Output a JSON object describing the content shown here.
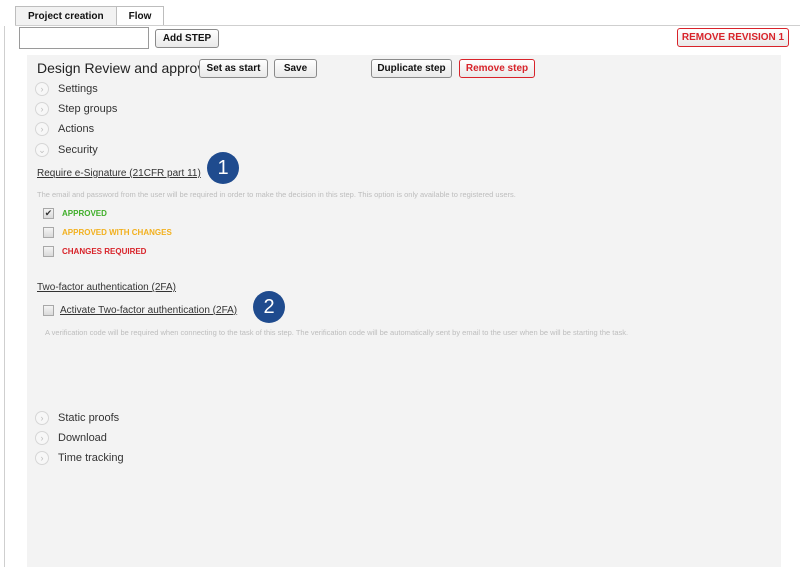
{
  "tabs": [
    {
      "label": "Project creation",
      "active": false
    },
    {
      "label": "Flow",
      "active": true
    }
  ],
  "toolbar": {
    "step_input_value": "",
    "add_step_label": "Add STEP",
    "remove_revision_label": "REMOVE REVISION 1"
  },
  "step": {
    "title": "Design Review and approval",
    "set_as_start_label": "Set as start",
    "save_label": "Save",
    "duplicate_label": "Duplicate step",
    "remove_label": "Remove step"
  },
  "sections_top": [
    {
      "label": "Settings",
      "icon": "chevron-right-icon"
    },
    {
      "label": "Step groups",
      "icon": "chevron-right-icon"
    },
    {
      "label": "Actions",
      "icon": "chevron-right-icon"
    },
    {
      "label": "Security",
      "icon": "chevron-down-icon"
    }
  ],
  "security": {
    "esign_title": "Require e-Signature (21CFR part 11)",
    "esign_hint": "The email and password from the user will be required in order to make the decision in this step. This option is only available to registered users.",
    "decisions": [
      {
        "label": "APPROVED",
        "checked": true,
        "color": "#3fae29"
      },
      {
        "label": "APPROVED WITH CHANGES",
        "checked": false,
        "color": "#f2b01e"
      },
      {
        "label": "CHANGES REQUIRED",
        "checked": false,
        "color": "#d8232a"
      }
    ],
    "twofa_title": "Two-factor authentication (2FA)",
    "twofa_checkbox_label": "Activate Two-factor authentication (2FA)",
    "twofa_checked": false,
    "twofa_hint": "A verification code will be required when connecting to the task of this step. The verification code will be automatically sent by email to the user when be will be starting the task."
  },
  "sections_bottom": [
    {
      "label": "Static proofs",
      "icon": "chevron-right-icon"
    },
    {
      "label": "Download",
      "icon": "chevron-right-icon"
    },
    {
      "label": "Time tracking",
      "icon": "chevron-right-icon"
    }
  ],
  "callouts": {
    "one": "1",
    "two": "2"
  },
  "colors": {
    "accent_red": "#d8232a",
    "callout_blue": "#1f4b8e",
    "panel_bg": "#f3f3f3"
  }
}
